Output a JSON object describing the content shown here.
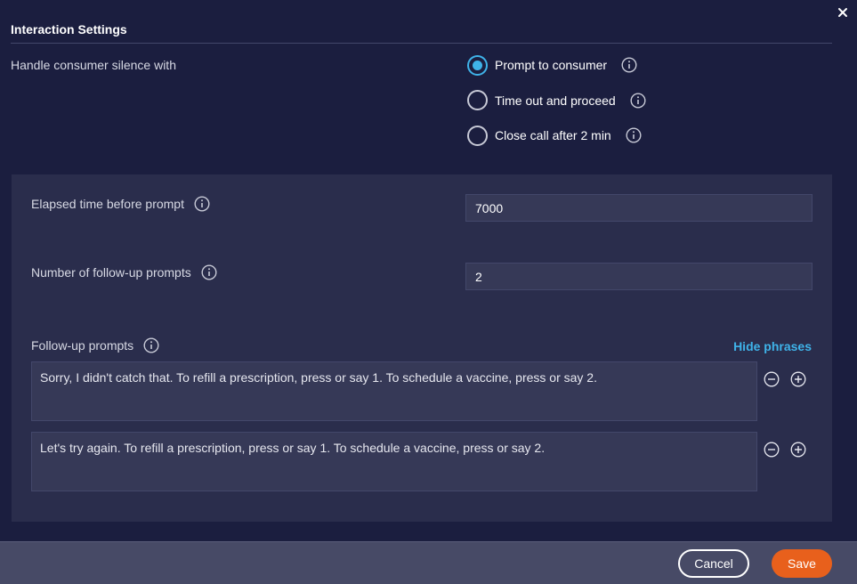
{
  "dialog": {
    "title": "Interaction Settings",
    "close_icon": "close-icon"
  },
  "silence": {
    "label": "Handle consumer silence with",
    "options": [
      {
        "label": "Prompt to consumer",
        "selected": true
      },
      {
        "label": "Time out and proceed",
        "selected": false
      },
      {
        "label": "Close call after 2 min",
        "selected": false
      }
    ]
  },
  "settings": {
    "elapsed_time": {
      "label": "Elapsed time before prompt",
      "value": "7000"
    },
    "followup_count": {
      "label": "Number of follow-up prompts",
      "value": "2"
    },
    "followup_prompts": {
      "label": "Follow-up prompts",
      "toggle_label": "Hide phrases",
      "items": [
        "Sorry, I didn't catch that. To refill a prescription, press or say 1. To schedule a vaccine, press or say 2.",
        "Let's try again. To refill a prescription, press or say 1. To schedule a vaccine, press or say 2."
      ]
    }
  },
  "footer": {
    "cancel_label": "Cancel",
    "save_label": "Save"
  },
  "colors": {
    "accent": "#3fb3e9",
    "primary_button": "#e8601c",
    "background": "#1b1e3f",
    "panel": "#2a2d4c"
  }
}
